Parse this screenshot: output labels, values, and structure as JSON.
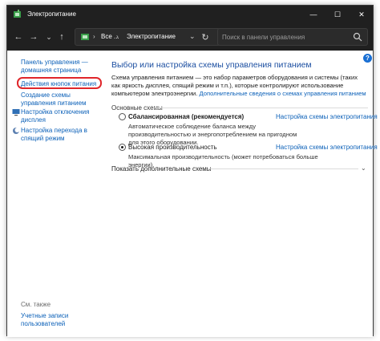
{
  "window": {
    "title": "Электропитание",
    "buttons": {
      "minimize": "—",
      "maximize": "☐",
      "close": "✕"
    }
  },
  "nav": {
    "back": "←",
    "forward": "→",
    "recent": "⌄",
    "up": "↑",
    "address": {
      "sep": "›",
      "crumb_1": "Все ...",
      "crumb_2": "Электропитание",
      "dropdown": "⌄"
    },
    "refresh": "↻",
    "search_placeholder": "Поиск в панели управления"
  },
  "sidebar": {
    "home": "Панель управления — домашняя страница",
    "power_buttons": "Действия кнопок питания",
    "create_plan": "Создание схемы управления питанием",
    "display_off": "Настройка отключения дисплея",
    "sleep": "Настройка перехода в спящий режим",
    "see_also": "См. также",
    "user_accounts": "Учетные записи пользователей"
  },
  "main": {
    "title": "Выбор или настройка схемы управления питанием",
    "description": "Схема управления питанием — это набор параметров оборудования и системы (таких как яркость дисплея, спящий режим и т.п.), которые контролируют использование компьютером электроэнергии. ",
    "description_link": "Дополнительные сведения о схемах управления питанием",
    "group_label": "Основные схемы",
    "plans": [
      {
        "name": "Сбалансированная (рекомендуется)",
        "link": "Настройка схемы электропитания",
        "description": "Автоматическое соблюдение баланса между производительностью и энергопотреблением на пригодном для этого оборудовании.",
        "selected": false
      },
      {
        "name": "Высокая производительность",
        "link": "Настройка схемы электропитания",
        "description": "Максимальная производительность (может потребоваться больше энергии).",
        "selected": true
      }
    ],
    "more_plans": "Показать дополнительные схемы",
    "help": "?"
  },
  "colors": {
    "accent": "#0b60b8",
    "title": "#1c4fa1",
    "highlight": "#e0262b",
    "chrome": "#202020"
  }
}
